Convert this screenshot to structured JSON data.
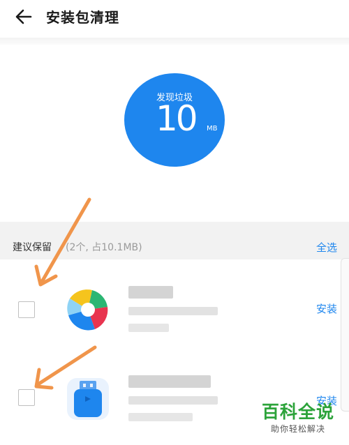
{
  "header": {
    "title": "安装包清理"
  },
  "summary": {
    "label": "发现垃圾",
    "value": "10",
    "unit": "MB"
  },
  "section": {
    "title": "建议保留",
    "count": "(2个, 占10.1MB)",
    "select_all": "全选"
  },
  "apps": [
    {
      "install_label": "安装",
      "icon": "pinwheel-app-icon"
    },
    {
      "install_label": "安装",
      "icon": "usb-drive-app-icon"
    }
  ],
  "watermark": {
    "brand": "百科全说",
    "slogan": "助你轻松解决"
  },
  "colors": {
    "accent": "#1e86ee",
    "annotation_arrow": "#f0954b",
    "watermark": "#2ca33a"
  }
}
